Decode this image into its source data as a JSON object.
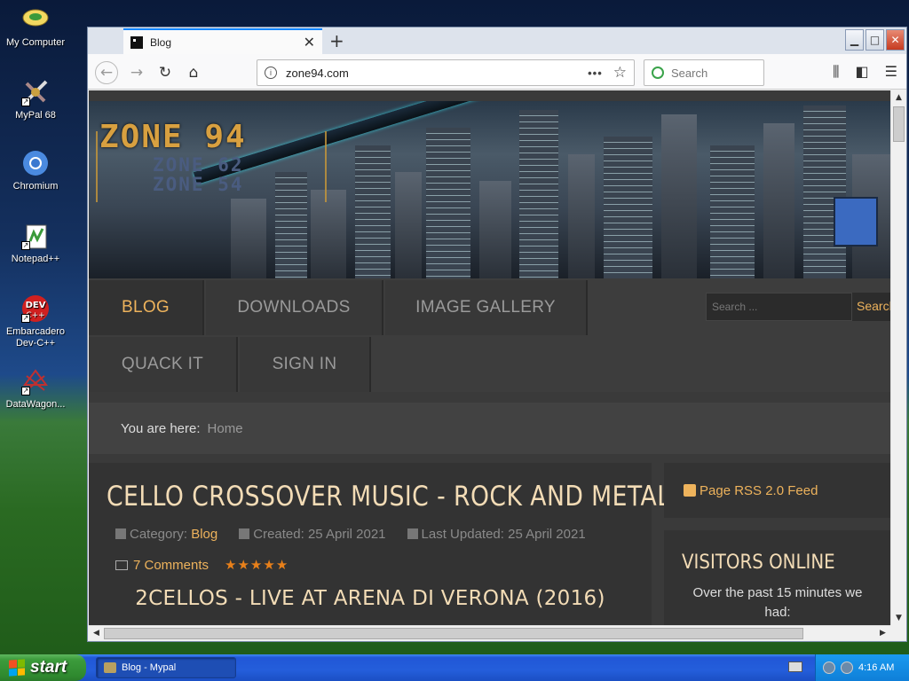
{
  "desktop": {
    "icons": [
      {
        "label": "My Computer"
      },
      {
        "label": "MyPal 68"
      },
      {
        "label": "Chromium"
      },
      {
        "label": "Notepad++"
      },
      {
        "label": "Embarcadero Dev-C++"
      },
      {
        "label": "DataWagon..."
      }
    ]
  },
  "browser": {
    "tab_title": "Blog",
    "url": "zone94.com",
    "search_placeholder": "Search"
  },
  "site": {
    "logo": {
      "line1": "ZONE 94",
      "line2": "ZONE 62",
      "line3": "ZONE 54"
    },
    "menu": [
      {
        "label": "BLOG",
        "active": true
      },
      {
        "label": "DOWNLOADS"
      },
      {
        "label": "IMAGE GALLERY"
      },
      {
        "label": "QUACK IT"
      },
      {
        "label": "SIGN IN"
      }
    ],
    "search_placeholder": "Search ...",
    "search_button": "Search",
    "breadcrumb": {
      "prefix": "You are here:",
      "current": "Home"
    },
    "article": {
      "title": "CELLO CROSSOVER MUSIC - ROCK AND METAL",
      "category_label": "Category:",
      "category": "Blog",
      "created": "Created: 25 April 2021",
      "updated": "Last Updated: 25 April 2021",
      "comments": "7 Comments",
      "rating_stars": 5,
      "subtitle": "2CELLOS - LIVE AT ARENA DI VERONA (2016)"
    },
    "sidebar": {
      "rss": "Page RSS 2.0 Feed",
      "visitors_title": "VISITORS ONLINE",
      "visitors_text": "Over the past 15 minutes we had:"
    }
  },
  "taskbar": {
    "start": "start",
    "task": "Blog - Mypal",
    "clock": "4:16 AM"
  },
  "colors": {
    "accent": "#eeb35c",
    "heading": "#f3dcb6",
    "xp_blue": "#245edb",
    "start_green": "#3c9c3c"
  }
}
